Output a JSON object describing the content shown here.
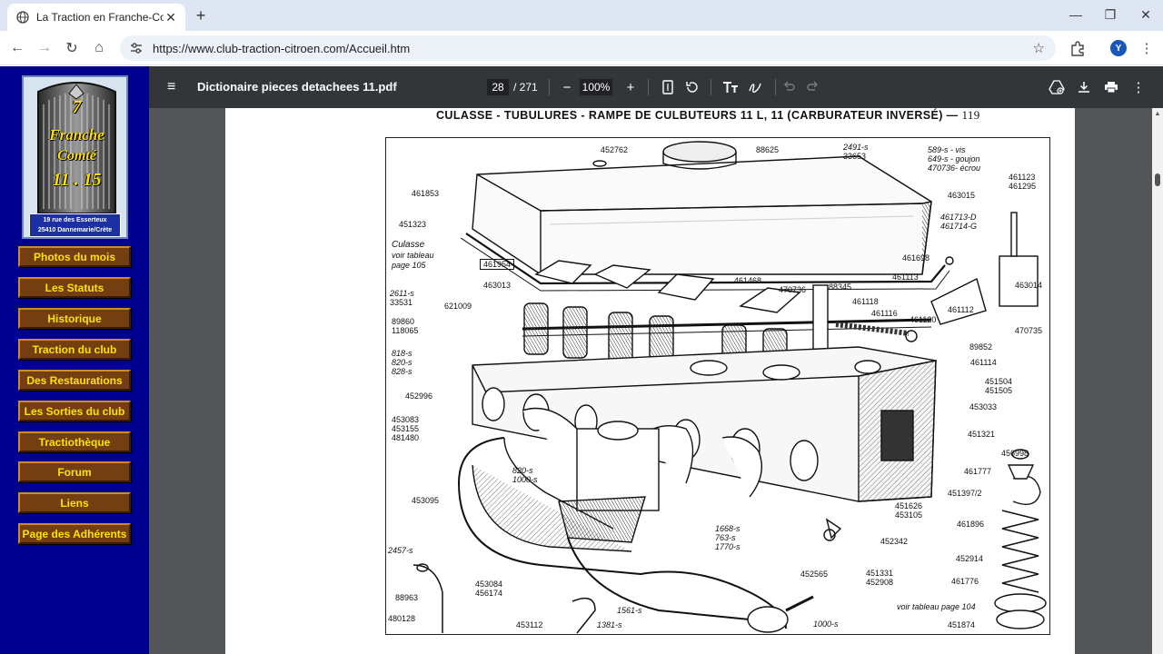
{
  "browser": {
    "tab_title": "La Traction en Franche-Comté",
    "tab_close": "✕",
    "new_tab": "+",
    "url": "https://www.club-traction-citroen.com/Accueil.htm",
    "profile_initial": "Y",
    "window_controls": {
      "minimize": "—",
      "maximize": "❐",
      "close": "✕"
    },
    "nav_icons": {
      "back": "←",
      "forward": "→",
      "reload": "↻",
      "home": "⌂"
    },
    "star": "☆",
    "kebab": "⋮"
  },
  "site": {
    "logo": {
      "line1": "7",
      "line2": "Franche",
      "line3": "Comté",
      "line4": "11 . 15",
      "address_line1": "19 rue des Esserteux",
      "address_line2": "25410 Dannemarie/Crète"
    },
    "menu": [
      "Photos du mois",
      "Les Statuts",
      "Historique",
      "Traction du club",
      "Des Restaurations",
      "Les Sorties du club",
      "Tractiothèque",
      "Forum",
      "Liens",
      "Page des Adhérents"
    ]
  },
  "pdf": {
    "title": "Dictionaire pieces detachees 11.pdf",
    "current_page": "28",
    "total_pages": "/ 271",
    "zoom": "100%",
    "menu_icon": "≡",
    "minus": "−",
    "plus": "+",
    "heading": "CULASSE - TUBULURES - RAMPE DE CULBUTEURS 11 L, 11 (CARBURATEUR INVERSÉ) —",
    "page_number": "119",
    "labels": {
      "l452762": "452762",
      "l88625": "88625",
      "l2491": "2491-s",
      "l33653": "33653",
      "l589": "589-s - vis",
      "l649": "649-s - goujon",
      "l470736e": "470736- écrou",
      "l461123": "461123",
      "l461295": "461295",
      "l463015": "463015",
      "l461853": "461853",
      "l451323": "451323",
      "culasse1": "Culasse",
      "culasse2": "voir tableau",
      "culasse3": "page 105",
      "l461954": "461954",
      "l463013": "463013",
      "l461713": "461713-D",
      "l461714": "461714-G",
      "l461698": "461698",
      "l461113": "461113",
      "l463014": "463014",
      "l461112": "461112",
      "l470735": "470735",
      "l2611": "2611-s",
      "l33531": "33531",
      "l621009": "621009",
      "l461468": "461468",
      "l470736": "470736",
      "l88345": "88345",
      "l461118": "461118",
      "l461116": "461116",
      "l461120": "461120",
      "l89860": "89860",
      "l118065": "118065",
      "l89852": "89852",
      "l818": "818-s",
      "l820": "820-s",
      "l828": "828-s",
      "l461114": "461114",
      "l451504": "451504",
      "l451505": "451505",
      "l452996": "452996",
      "l453033": "453033",
      "l453083": "453083",
      "l453155": "453155",
      "l481480": "481480",
      "l451321": "451321",
      "l820b": "820-s",
      "l1000": "1000-s",
      "l456998": "456998",
      "l461777": "461777",
      "l453095": "453095",
      "l451397": "451397/2",
      "l451626": "451626",
      "l453105": "453105",
      "l461896": "461896",
      "l1668": "1668-s",
      "l763": "763-s",
      "l1770": "1770-s",
      "l452342": "452342",
      "l2457": "2457-s",
      "l452914": "452914",
      "l452565": "452565",
      "l451331": "451331",
      "l452908": "452908",
      "l461776": "461776",
      "l88963": "88963",
      "l453084": "453084",
      "l456174": "456174",
      "l1561": "1561-s",
      "l1000b": "1000-s",
      "voir104": "voir tableau page 104",
      "l480128": "480128",
      "l453112": "453112",
      "l1381": "1381-s",
      "l451874": "451874"
    }
  }
}
